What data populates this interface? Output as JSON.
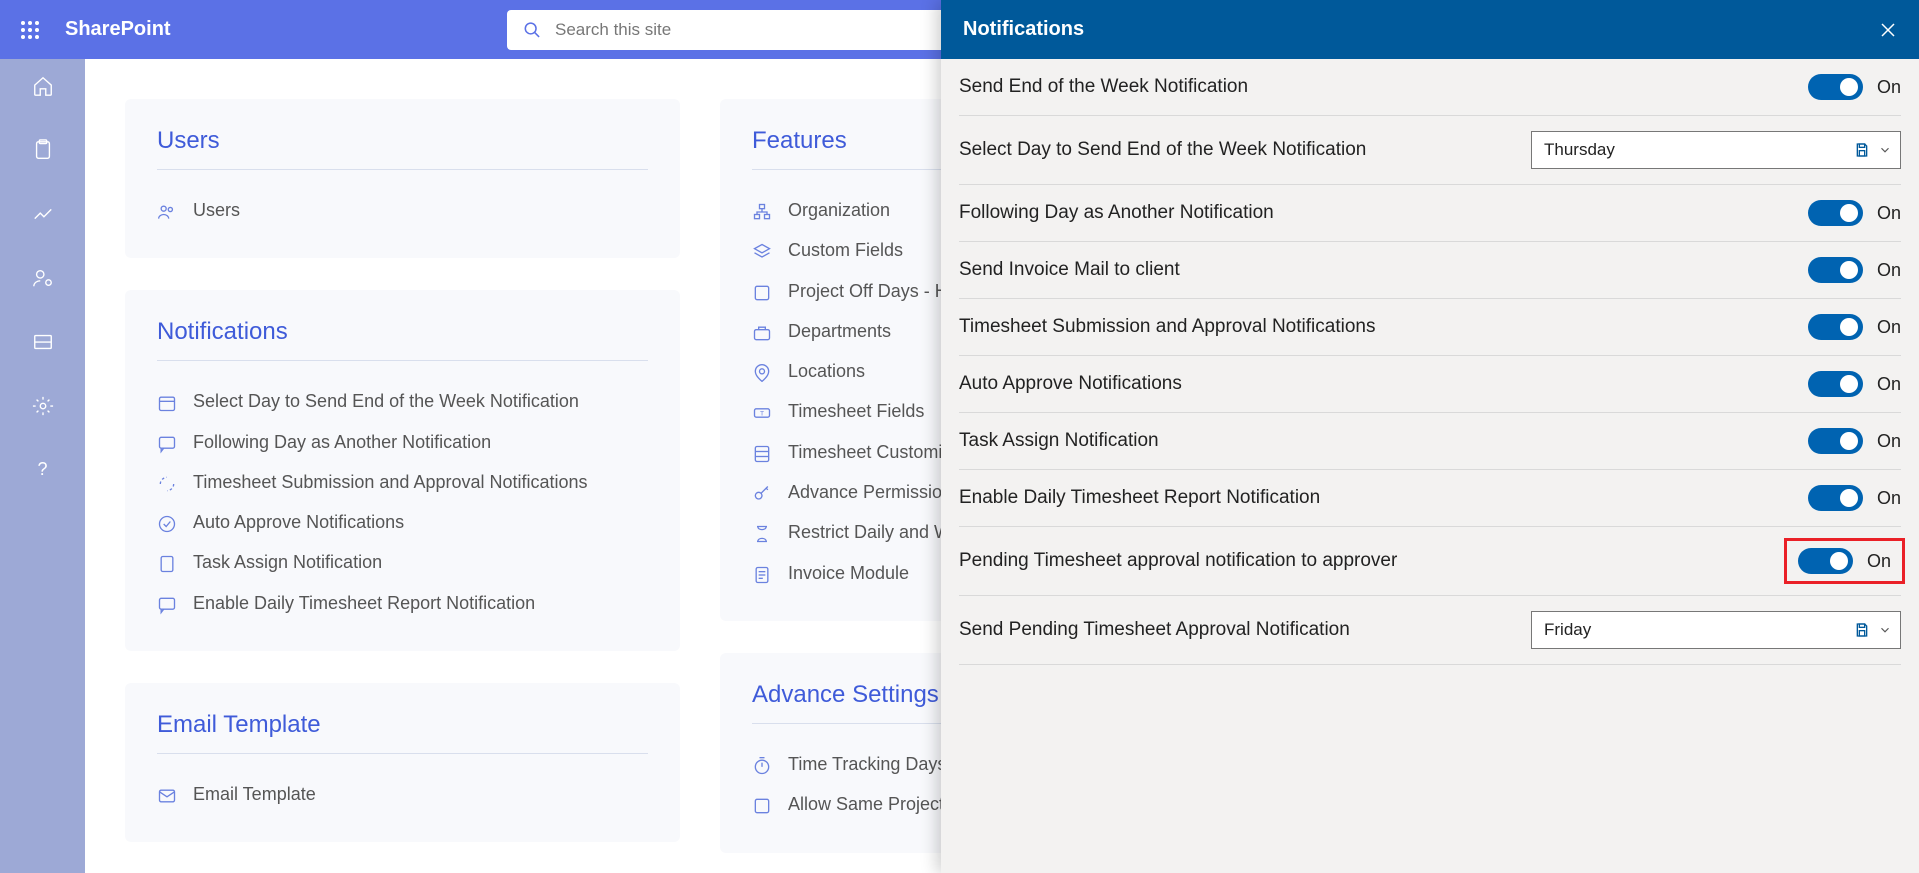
{
  "header": {
    "brand": "SharePoint",
    "search_ph": "Search this site"
  },
  "cards": {
    "users": {
      "title": "Users",
      "items": [
        "Users"
      ]
    },
    "notifications": {
      "title": "Notifications",
      "items": [
        "Select Day to Send End of the Week Notification",
        "Following Day as Another Notification",
        "Timesheet Submission and Approval Notifications",
        "Auto Approve Notifications",
        "Task Assign Notification",
        "Enable Daily Timesheet Report Notification"
      ]
    },
    "email": {
      "title": "Email Template",
      "items": [
        "Email Template"
      ]
    },
    "features": {
      "title": "Features",
      "items": [
        "Organization",
        "Custom Fields",
        "Project Off Days - Ho",
        "Departments",
        "Locations",
        "Timesheet Fields",
        "Timesheet Customiza",
        "Advance Permissions",
        "Restrict Daily and We",
        "Invoice Module"
      ]
    },
    "advance": {
      "title": "Advance Settings",
      "items": [
        "Time Tracking Days",
        "Allow Same Project N"
      ]
    }
  },
  "panel": {
    "title": "Notifications",
    "rows": [
      {
        "label": "Send End of the Week Notification",
        "type": "toggle",
        "state": "On"
      },
      {
        "label": "Select Day to Send End of the Week Notification",
        "type": "select",
        "value": "Thursday"
      },
      {
        "label": "Following Day as Another Notification",
        "type": "toggle",
        "state": "On"
      },
      {
        "label": "Send Invoice Mail to client",
        "type": "toggle",
        "state": "On"
      },
      {
        "label": "Timesheet Submission and Approval Notifications",
        "type": "toggle",
        "state": "On"
      },
      {
        "label": "Auto Approve Notifications",
        "type": "toggle",
        "state": "On"
      },
      {
        "label": "Task Assign Notification",
        "type": "toggle",
        "state": "On"
      },
      {
        "label": "Enable Daily Timesheet Report Notification",
        "type": "toggle",
        "state": "On"
      },
      {
        "label": "Pending Timesheet approval notification to approver",
        "type": "toggle",
        "state": "On",
        "hl": true
      },
      {
        "label": "Send Pending Timesheet Approval Notification",
        "type": "select",
        "value": "Friday"
      }
    ]
  }
}
